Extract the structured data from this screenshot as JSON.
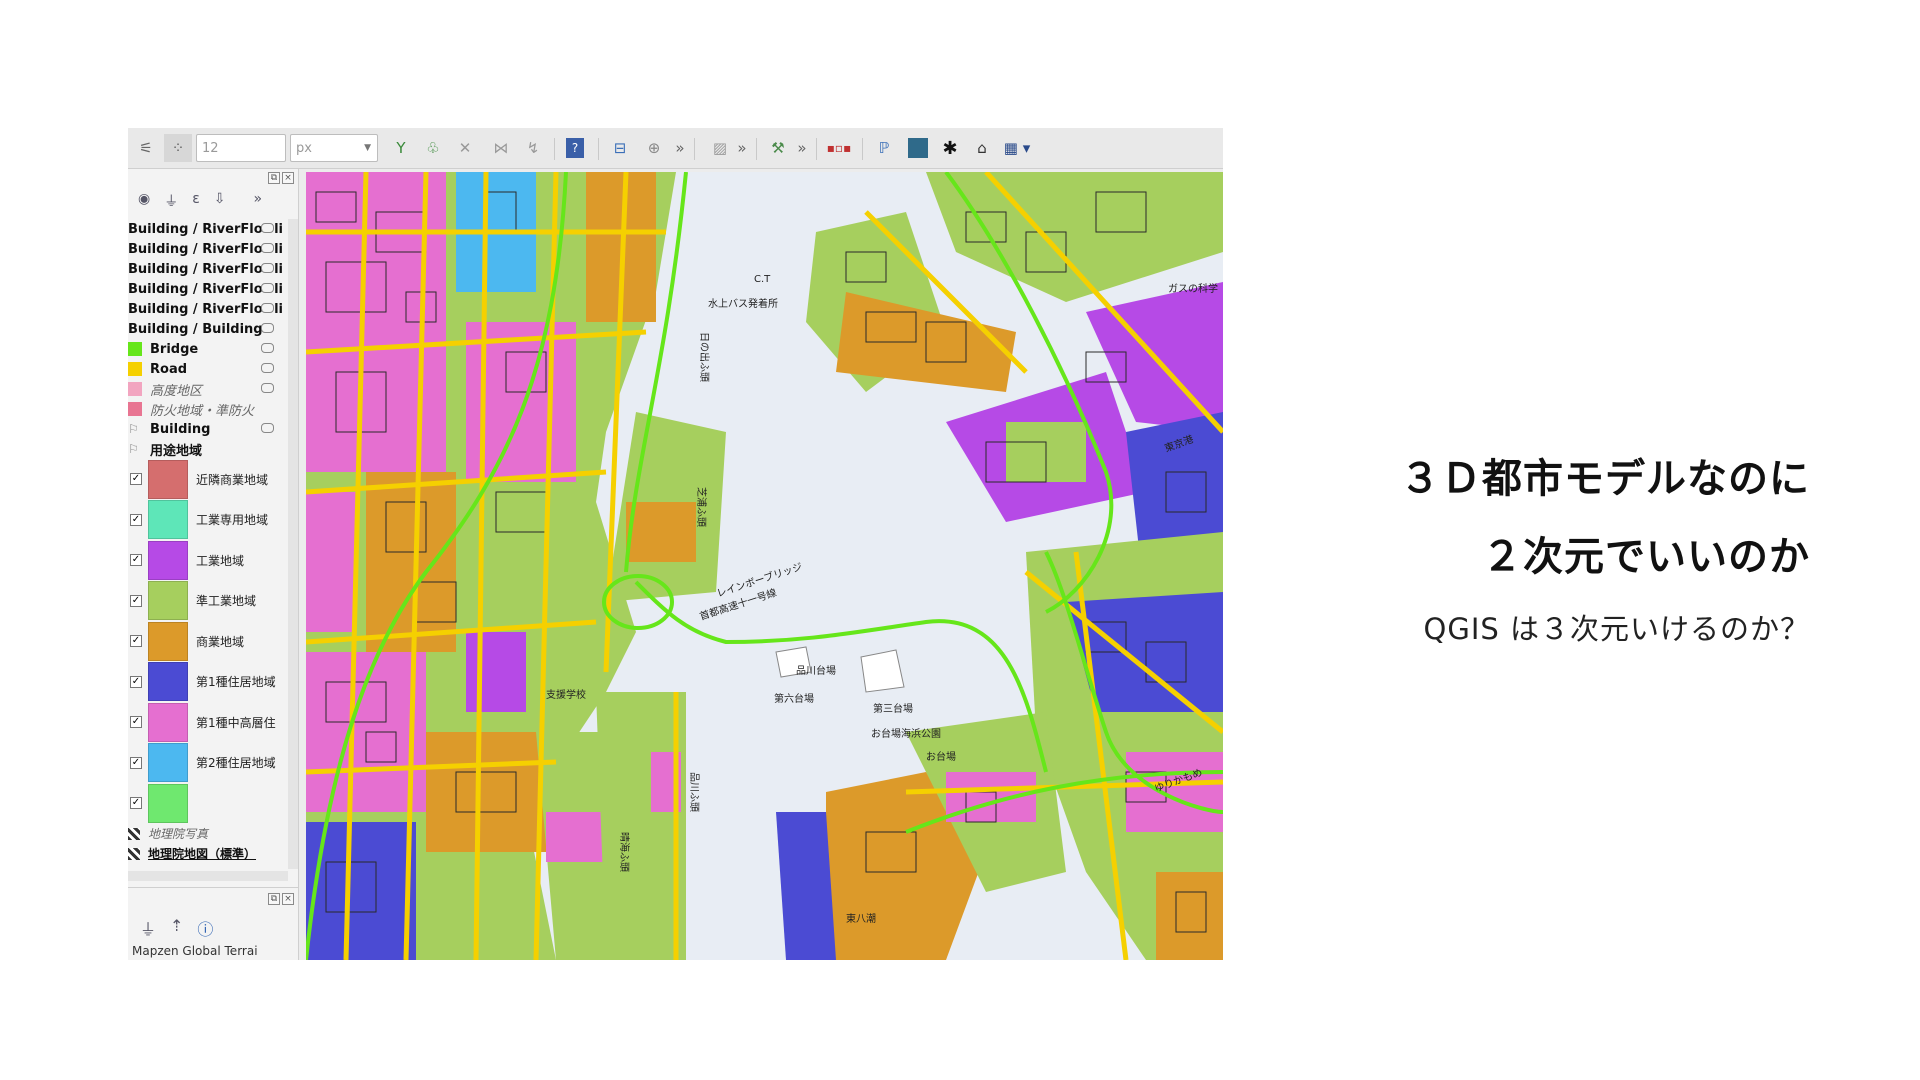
{
  "toolbar": {
    "size_value": "12",
    "unit_value": "px",
    "more_label": "»"
  },
  "layers_panel": {
    "rows": [
      {
        "label": "Building / RiverFlo",
        "suffix": "li",
        "swatch": ""
      },
      {
        "label": "Building / RiverFlo",
        "suffix": "li",
        "swatch": ""
      },
      {
        "label": "Building / RiverFlo",
        "suffix": "li",
        "swatch": ""
      },
      {
        "label": "Building / RiverFlo",
        "suffix": "li",
        "swatch": ""
      },
      {
        "label": "Building / RiverFlo",
        "suffix": "li",
        "swatch": ""
      },
      {
        "label": "Building / Building",
        "suffix": "",
        "swatch": ""
      },
      {
        "label": "Bridge",
        "suffix": "",
        "swatch": "#66e61a"
      },
      {
        "label": "Road",
        "suffix": "",
        "swatch": "#f5d000"
      },
      {
        "label": "高度地区",
        "suffix": "",
        "swatch": "#f2a5c0",
        "italic": true
      },
      {
        "label": "防火地域・準防火",
        "suffix": "",
        "swatch": "#e87592",
        "italic": true
      },
      {
        "label": "Building",
        "suffix": "",
        "swatch": "",
        "bold": true
      },
      {
        "label": "用途地域",
        "suffix": "",
        "swatch": "",
        "bold": true
      }
    ],
    "categories": [
      {
        "label": "近隣商業地域",
        "color": "#d56e6e"
      },
      {
        "label": "工業専用地域",
        "color": "#5ee6b8"
      },
      {
        "label": "工業地域",
        "color": "#b64ae6"
      },
      {
        "label": "準工業地域",
        "color": "#a6cf5e"
      },
      {
        "label": "商業地域",
        "color": "#dc9a2a"
      },
      {
        "label": "第1種住居地域",
        "color": "#4b4bd3"
      },
      {
        "label": "第1種中高層住",
        "color": "#e56fd0"
      },
      {
        "label": "第2種住居地域",
        "color": "#4cb8f0"
      },
      {
        "label": "",
        "color": "#6fe86f"
      }
    ],
    "basemaps": [
      {
        "label": "地理院写真",
        "italic": true
      },
      {
        "label": "地理院地図（標準）",
        "bold": true
      }
    ],
    "panel2_text": "Mapzen Global Terrai"
  },
  "map": {
    "labels": [
      "水上バス発着所",
      "日の出ふ頭",
      "芝浦ふ頭",
      "レインボーブリッジ",
      "首都高速十一号線",
      "品川台場",
      "第六台場",
      "第三台場",
      "お台場海浜公園",
      "お台場",
      "ガスの科学",
      "東京港",
      "ゆりかもめ",
      "品川ふ頭",
      "支援学校",
      "東八潮",
      "C.T",
      "晴海ふ頭"
    ],
    "colors": {
      "water": "#e8edf4",
      "commercial": "#dc9a2a",
      "quasi_industrial": "#a6cf5e",
      "industrial": "#b64ae6",
      "residential1": "#4b4bd3",
      "mid_high": "#e56fd0",
      "residential2": "#4cb8f0",
      "road": "#f5d000",
      "bridge": "#66e61a",
      "building": "#2a2a2a"
    }
  },
  "slide": {
    "title_line1": "３Ｄ都市モデルなのに",
    "title_line2": "２次元でいいのか",
    "subtitle": "QGIS は３次元いけるのか？"
  }
}
